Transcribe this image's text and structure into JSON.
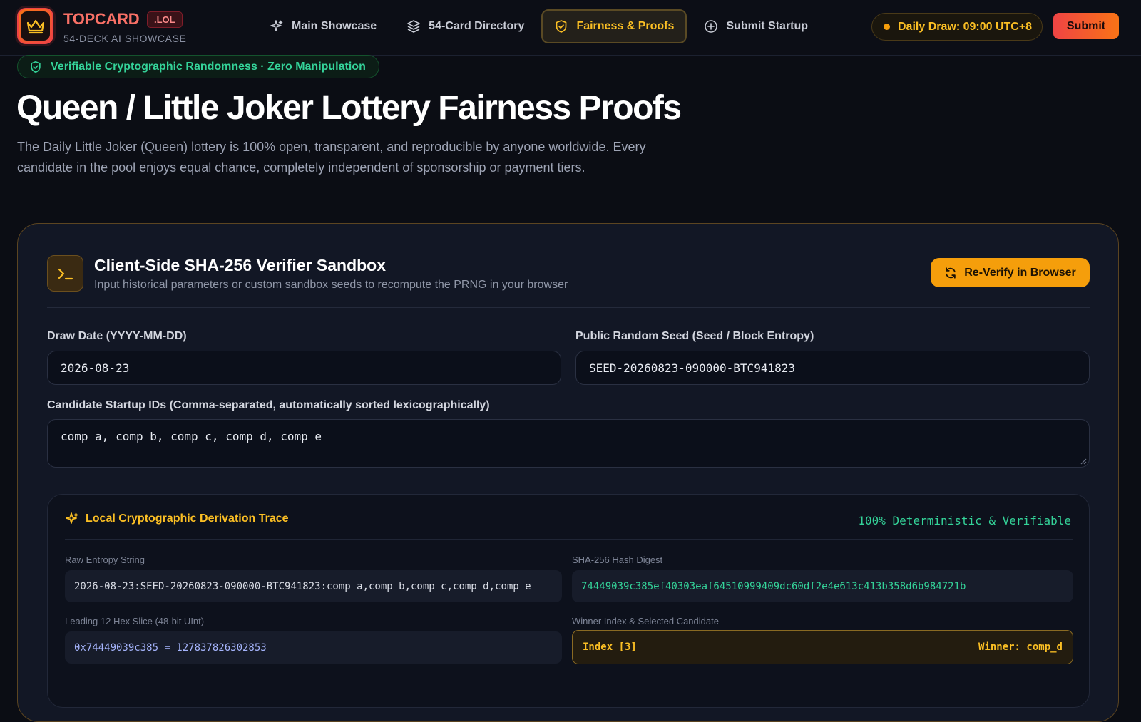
{
  "brand": {
    "name": "TOPCARD",
    "tld": ".LOL",
    "tagline": "54-DECK AI SHOWCASE"
  },
  "nav": {
    "items": [
      {
        "label": "Main Showcase",
        "icon": "sparkle-icon"
      },
      {
        "label": "54-Card Directory",
        "icon": "layers-icon"
      },
      {
        "label": "Fairness & Proofs",
        "icon": "shield-icon",
        "active": true
      },
      {
        "label": "Submit Startup",
        "icon": "plus-circle-icon"
      }
    ],
    "daily_draw": "Daily Draw: 09:00 UTC+8",
    "submit_label": "Submit"
  },
  "hero": {
    "badge": "Verifiable Cryptographic Randomness · Zero Manipulation",
    "title": "Queen / Little Joker Lottery Fairness Proofs",
    "description": "The Daily Little Joker (Queen) lottery is 100% open, transparent, and reproducible by anyone worldwide. Every candidate in the pool enjoys equal chance, completely independent of sponsorship or payment tiers."
  },
  "sandbox": {
    "title": "Client-Side SHA-256 Verifier Sandbox",
    "subtitle": "Input historical parameters or custom sandbox seeds to recompute the PRNG in your browser",
    "reverify_label": "Re-Verify in Browser",
    "draw_date_label": "Draw Date (YYYY-MM-DD)",
    "draw_date_value": "2026-08-23",
    "seed_label": "Public Random Seed (Seed / Block Entropy)",
    "seed_value": "SEED-20260823-090000-BTC941823",
    "candidates_label": "Candidate Startup IDs (Comma-separated, automatically sorted lexicographically)",
    "candidates_value": "comp_a, comp_b, comp_c, comp_d, comp_e"
  },
  "trace": {
    "title": "Local Cryptographic Derivation Trace",
    "status": "100% Deterministic & Verifiable",
    "raw_entropy_label": "Raw Entropy String",
    "raw_entropy_value": "2026-08-23:SEED-20260823-090000-BTC941823:comp_a,comp_b,comp_c,comp_d,comp_e",
    "hash_label": "SHA-256 Hash Digest",
    "hash_value": "74449039c385ef40303eaf64510999409dc60df2e4e613c413b358d6b984721b",
    "slice_label": "Leading 12 Hex Slice (48-bit UInt)",
    "slice_value": "0x74449039c385 = 127837826302853",
    "winner_label": "Winner Index & Selected Candidate",
    "winner_index": "Index [3]",
    "winner_name": "Winner: comp_d"
  }
}
